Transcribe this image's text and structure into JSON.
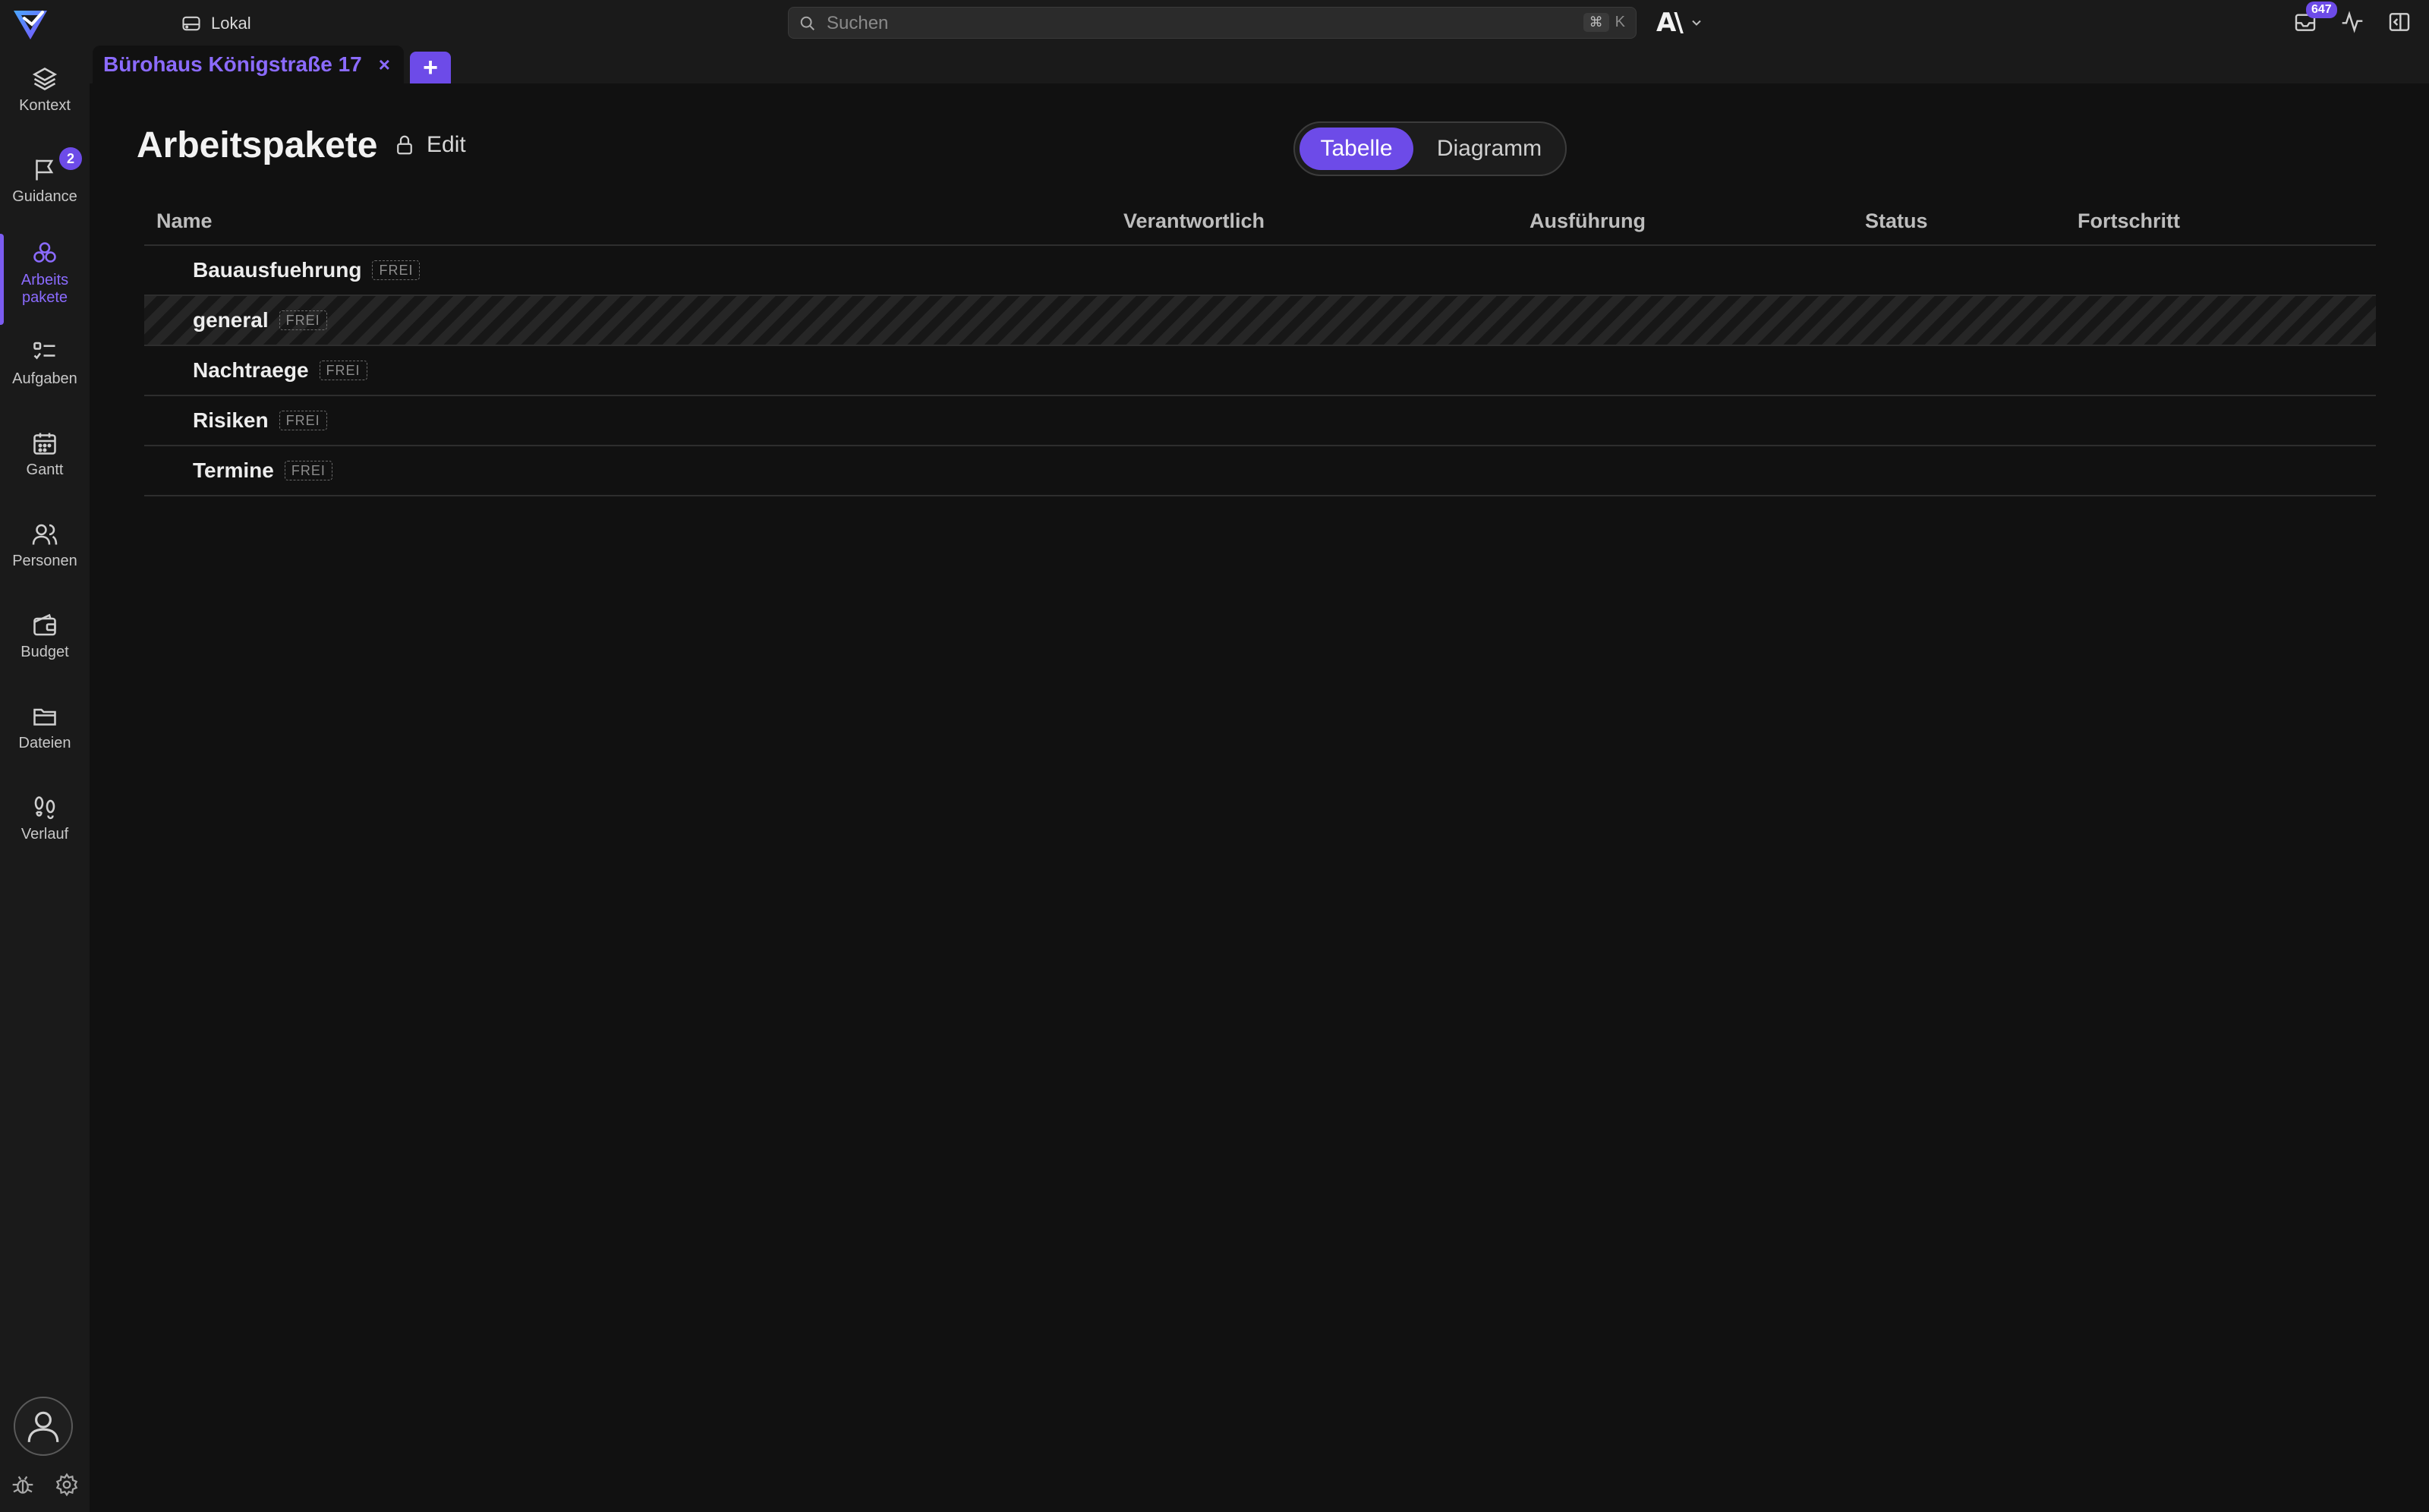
{
  "topbar": {
    "workspace_label": "Lokal",
    "search_placeholder": "Suchen",
    "search_shortcut_key1": "⌘",
    "search_shortcut_key2": "K",
    "brand_mark": "A\\",
    "inbox_count": "647"
  },
  "sidebar": {
    "items": [
      {
        "label": "Kontext",
        "icon": "layers-icon"
      },
      {
        "label": "Guidance",
        "icon": "flag-icon",
        "badge": "2"
      },
      {
        "label_line1": "Arbeits",
        "label_line2": "pakete",
        "icon": "packages-icon"
      },
      {
        "label": "Aufgaben",
        "icon": "checklist-icon"
      },
      {
        "label": "Gantt",
        "icon": "calendar-icon"
      },
      {
        "label": "Personen",
        "icon": "people-icon"
      },
      {
        "label": "Budget",
        "icon": "wallet-icon"
      },
      {
        "label": "Dateien",
        "icon": "folder-icon"
      },
      {
        "label": "Verlauf",
        "icon": "footprints-icon"
      }
    ]
  },
  "tabs": {
    "document_tab_label": "Bürohaus Königstraße 17",
    "close_glyph": "×",
    "add_glyph": "+"
  },
  "main": {
    "title": "Arbeitspakete",
    "edit_label": "Edit",
    "view_toggle": {
      "table": "Tabelle",
      "diagram": "Diagramm",
      "selected": "Tabelle"
    }
  },
  "table": {
    "columns": [
      "Name",
      "Verantwortlich",
      "Ausführung",
      "Status",
      "Fortschritt"
    ],
    "rows": [
      {
        "name": "Bauausfuehrung",
        "tag": "FREI"
      },
      {
        "name": "general",
        "tag": "FREI"
      },
      {
        "name": "Nachtraege",
        "tag": "FREI"
      },
      {
        "name": "Risiken",
        "tag": "FREI"
      },
      {
        "name": "Termine",
        "tag": "FREI"
      }
    ]
  },
  "colors": {
    "accent": "#6d4be8",
    "accent_text": "#8b6bff",
    "background": "#111111",
    "chrome": "#1a1a1a"
  }
}
